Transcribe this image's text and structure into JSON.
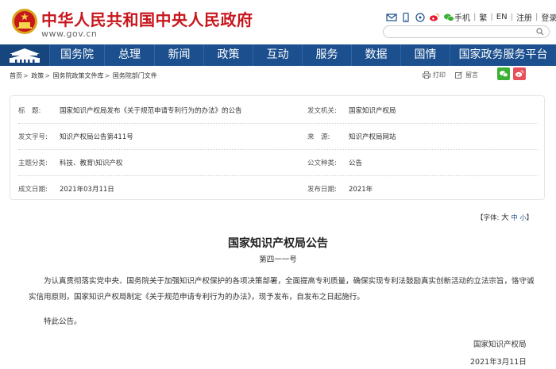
{
  "header": {
    "site_title": "中华人民共和国中央人民政府",
    "site_url": "www.gov.cn",
    "links": [
      "手机",
      "繁",
      "EN",
      "注册",
      "登录"
    ],
    "search_placeholder": ""
  },
  "nav": {
    "items": [
      "国务院",
      "总理",
      "新闻",
      "政策",
      "互动",
      "服务",
      "数据",
      "国情",
      "国家政务服务平台"
    ]
  },
  "breadcrumb": [
    "首页",
    "政策",
    "国务院政策文件库",
    "国务院部门文件"
  ],
  "tools": {
    "print": "打印",
    "leave_message": "留言"
  },
  "info": {
    "title_label": "标　题:",
    "title_value": "国家知识产权局发布《关于规范申请专利行为的办法》的公告",
    "issuer_label": "发文机关:",
    "issuer_value": "国家知识产权局",
    "doc_no_label": "发文字号:",
    "doc_no_value": "知识产权局公告第411号",
    "source_label": "来　源:",
    "source_value": "知识产权局网站",
    "topic_label": "主题分类:",
    "topic_value": "科技、教育\\知识产权",
    "type_label": "公文种类:",
    "type_value": "公告",
    "date_label": "成文日期:",
    "date_value": "2021年03月11日",
    "pub_label": "发布日期:",
    "pub_value": "2021年"
  },
  "font_size": {
    "prefix": "【字体:",
    "large": "大",
    "medium": "中",
    "small": "小",
    "suffix": "】"
  },
  "article": {
    "title": "国家知识产权局公告",
    "number": "第四一一号",
    "para1": "为认真贯彻落实党中央、国务院关于加强知识产权保护的各项决策部署，全面提高专利质量，确保实现专利法鼓励真实创新活动的立法宗旨，恪守诚实信用原则，国家知识产权局制定《关于规范申请专利行为的办法》，现予发布，自发布之日起施行。",
    "para2": "特此公告。",
    "signature": "国家知识产权局",
    "sign_date": "2021年3月11日"
  },
  "colors": {
    "brand_red": "#c8161d",
    "nav_blue": "#1b4f8e"
  }
}
